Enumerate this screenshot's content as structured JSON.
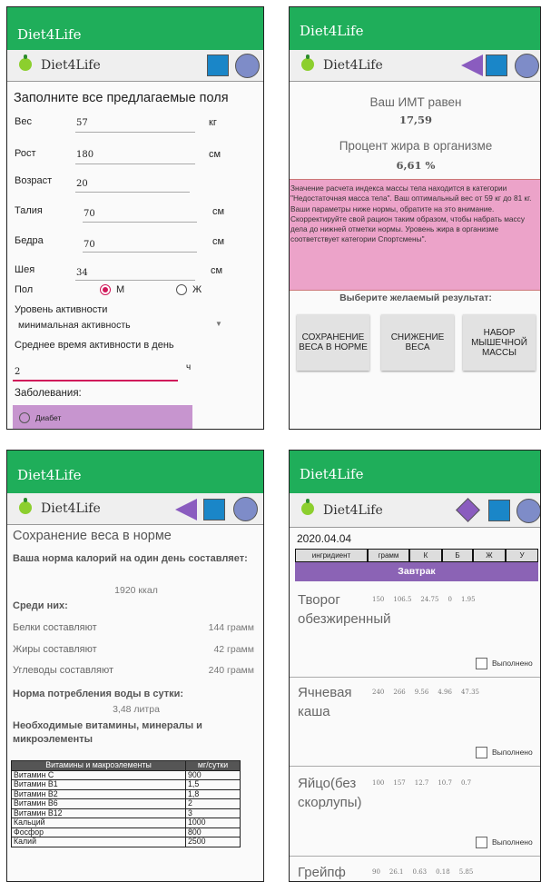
{
  "app": {
    "title": "Diet4Life",
    "brand": "Diet4Life",
    "colors": {
      "green": "#1fae5a",
      "blue": "#1a86c8",
      "purple": "#8a5cbf",
      "pink": "#eca3c9"
    }
  },
  "form": {
    "heading": "Заполните все предлагаемые поля",
    "fields": [
      {
        "label": "Вес",
        "value": "57",
        "unit": "кг"
      },
      {
        "label": "Рост",
        "value": "180",
        "unit": "см"
      },
      {
        "label": "Возраст",
        "value": "20",
        "unit": ""
      },
      {
        "label": "Талия",
        "value": "70",
        "unit": "см"
      },
      {
        "label": "Бедра",
        "value": "70",
        "unit": "см"
      },
      {
        "label": "Шея",
        "value": "34",
        "unit": "см"
      }
    ],
    "sex_label": "Пол",
    "sex_m": "М",
    "sex_f": "Ж",
    "activity_label": "Уровень активности",
    "activity_value": "минимальная активность",
    "time_label": "Среднее время активности в день",
    "time_value": "2",
    "time_unit": "ч",
    "disease_label": "Заболевания:",
    "disease_item": "Диабет"
  },
  "result": {
    "bmi_label": "Ваш ИМТ равен",
    "bmi_value": "17,59",
    "fat_label": "Процент жира в организме",
    "fat_value": "6,61 %",
    "advice": "Значение расчета индекса массы тела находится в категории \"Недостаточная масса тела\". Ваш оптимальный вес от 59 кг до 81 кг. Ваши параметры ниже нормы, обратите на это внимание. Скорректируйте свой рацион таким образом, чтобы набрать массу дела до нижней отметки нормы. Уровень жира в организме соответствует категории Спортсмены\".",
    "choose": "Выберите желаемый результат:",
    "btn1": "СОХРАНЕНИЕ ВЕСА В НОРМЕ",
    "btn2": "СНИЖЕНИЕ ВЕСА",
    "btn3": "НАБОР МЫШЕЧНОЙ МАССЫ"
  },
  "norm": {
    "title": "Сохранение веса в норме",
    "cal_label": "Ваша норма калорий на один день составляет:",
    "cal_value": "1920 ккал",
    "among": "Среди них:",
    "rows": [
      {
        "label": "Белки составляют",
        "value": "144 грамм"
      },
      {
        "label": "Жиры составляют",
        "value": "42 грамм"
      },
      {
        "label": "Углеводы составляют",
        "value": "240 грамм"
      }
    ],
    "water_label": "Норма потребления воды в сутки:",
    "water_value": "3,48 литра",
    "vit_label": "Необходимые витамины, минералы и микроэлементы",
    "table_head": [
      "Витамины и макроэлементы",
      "мг/сутки"
    ],
    "table_rows": [
      [
        "Витамин С",
        "900"
      ],
      [
        "Витамин В1",
        "1,5"
      ],
      [
        "Витамин В2",
        "1,8"
      ],
      [
        "Витамин В6",
        "2"
      ],
      [
        "Витамин В12",
        "3"
      ],
      [
        "Кальций",
        "1000"
      ],
      [
        "Фосфор",
        "800"
      ],
      [
        "Калий",
        "2500"
      ]
    ]
  },
  "menu": {
    "date": "2020.04.04",
    "head": [
      "ингридиент",
      "грамм",
      "К",
      "Б",
      "Ж",
      "У"
    ],
    "meal": "Завтрак",
    "done_label": "Выполнено",
    "items": [
      {
        "name": "Творог обезжиренный",
        "g": "150",
        "k": "106.5",
        "b": "24.75",
        "j": "0",
        "u": "1.95"
      },
      {
        "name": "Ячневая каша",
        "g": "240",
        "k": "266",
        "b": "9.56",
        "j": "4.96",
        "u": "47.35"
      },
      {
        "name": "Яйцо(без скорлупы)",
        "g": "100",
        "k": "157",
        "b": "12.7",
        "j": "10.7",
        "u": "0.7"
      },
      {
        "name": "Грейпф",
        "g": "90",
        "k": "26.1",
        "b": "0.63",
        "j": "0.18",
        "u": "5.85"
      }
    ]
  }
}
